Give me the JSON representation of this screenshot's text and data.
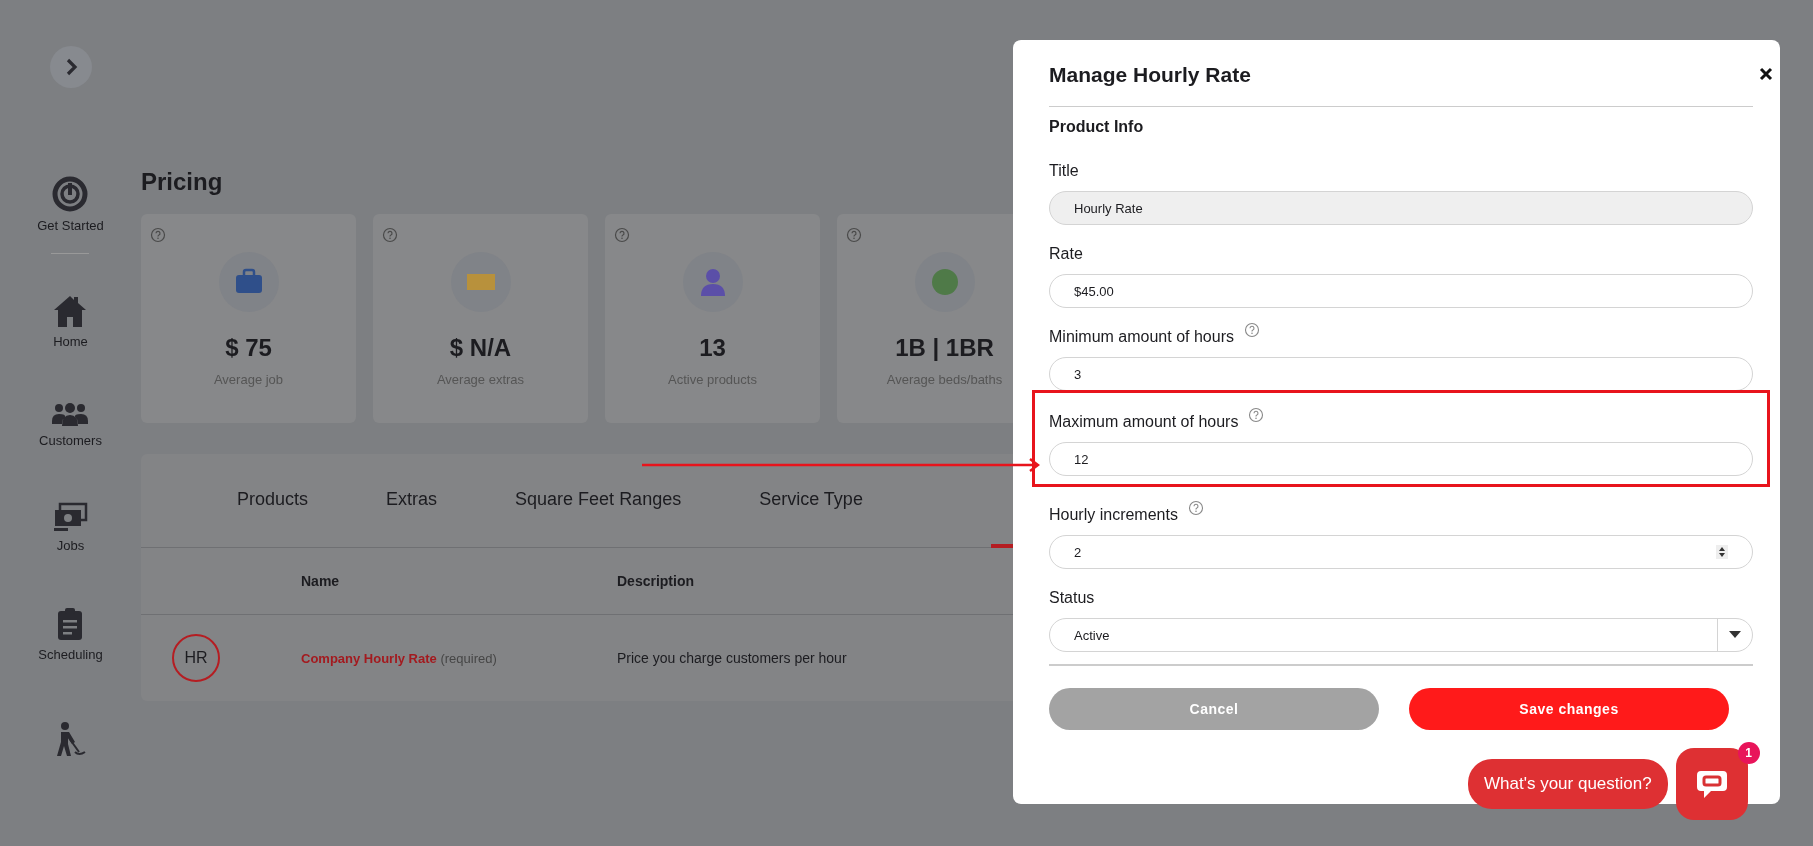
{
  "sidebar": {
    "items": [
      {
        "label": "Get Started"
      },
      {
        "label": "Home"
      },
      {
        "label": "Customers"
      },
      {
        "label": "Jobs"
      },
      {
        "label": "Scheduling"
      }
    ]
  },
  "page": {
    "title": "Pricing"
  },
  "stats": [
    {
      "value": "$ 75",
      "label": "Average job",
      "color": "#2f4f8a"
    },
    {
      "value": "$ N/A",
      "label": "Average extras",
      "color": "#b8913c"
    },
    {
      "value": "13",
      "label": "Active products",
      "color": "#5b4fa8"
    },
    {
      "value": "1B | 1BR",
      "label": "Average beds/baths",
      "color": "#4f7a48"
    }
  ],
  "tabs": [
    {
      "label": "Products",
      "selected": false
    },
    {
      "label": "Extras",
      "selected": false
    },
    {
      "label": "Square Feet Ranges",
      "selected": false
    },
    {
      "label": "Service Type",
      "selected": false
    }
  ],
  "table": {
    "columns": [
      "Name",
      "Description"
    ],
    "rows": [
      {
        "initials": "HR",
        "name": "Company Hourly Rate",
        "note": "(required)",
        "description": "Price you charge customers per hour"
      }
    ]
  },
  "modal": {
    "title": "Manage Hourly Rate",
    "section": "Product Info",
    "fields": [
      {
        "label": "Title",
        "value": "Hourly Rate",
        "kind": "text",
        "disabled": true,
        "help": false,
        "highlighted": false
      },
      {
        "label": "Rate",
        "value": "$45.00",
        "kind": "text",
        "disabled": false,
        "help": false,
        "highlighted": false
      },
      {
        "label": "Minimum amount of hours",
        "value": "3",
        "kind": "text",
        "disabled": false,
        "help": true,
        "highlighted": false
      },
      {
        "label": "Maximum amount of hours",
        "value": "12",
        "kind": "text",
        "disabled": false,
        "help": true,
        "highlighted": true
      },
      {
        "label": "Hourly increments",
        "value": "2",
        "kind": "number",
        "disabled": false,
        "help": true,
        "highlighted": false
      },
      {
        "label": "Status",
        "value": "Active",
        "kind": "select",
        "disabled": false,
        "help": false,
        "highlighted": false
      }
    ],
    "buttons": [
      {
        "label": "Cancel",
        "kind": "secondary"
      },
      {
        "label": "Save changes",
        "kind": "primary"
      }
    ]
  },
  "chat": {
    "prompt": "What's your question?",
    "badge": "1"
  }
}
